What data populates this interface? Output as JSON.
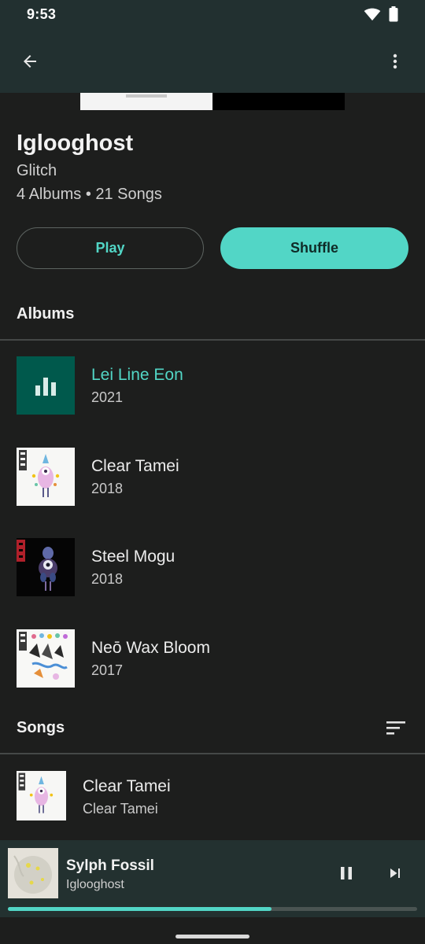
{
  "status_bar": {
    "time": "9:53",
    "icons": [
      "wifi-icon",
      "battery-icon"
    ]
  },
  "app_bar": {
    "back_icon": "arrow-back-icon",
    "menu_icon": "more-vert-icon"
  },
  "artist": {
    "name": "Iglooghost",
    "genre": "Glitch",
    "counts": "4 Albums • 21 Songs"
  },
  "actions": {
    "play_label": "Play",
    "shuffle_label": "Shuffle"
  },
  "albums_section": {
    "title": "Albums",
    "items": [
      {
        "title": "Lei Line Eon",
        "year": "2021",
        "now_playing": true
      },
      {
        "title": "Clear Tamei",
        "year": "2018",
        "now_playing": false
      },
      {
        "title": "Steel Mogu",
        "year": "2018",
        "now_playing": false
      },
      {
        "title": "Neō Wax Bloom",
        "year": "2017",
        "now_playing": false
      }
    ]
  },
  "songs_section": {
    "title": "Songs",
    "sort_icon": "sort-icon",
    "items": [
      {
        "title": "Clear Tamei",
        "subtitle": "Clear Tamei"
      }
    ]
  },
  "now_playing": {
    "title": "Sylph Fossil",
    "artist": "Iglooghost",
    "progress": 0.645,
    "pause_icon": "pause-icon",
    "next_icon": "skip-next-icon"
  },
  "colors": {
    "accent": "#52d6c6",
    "background": "#1d1e1d",
    "toolbar": "#223030"
  }
}
